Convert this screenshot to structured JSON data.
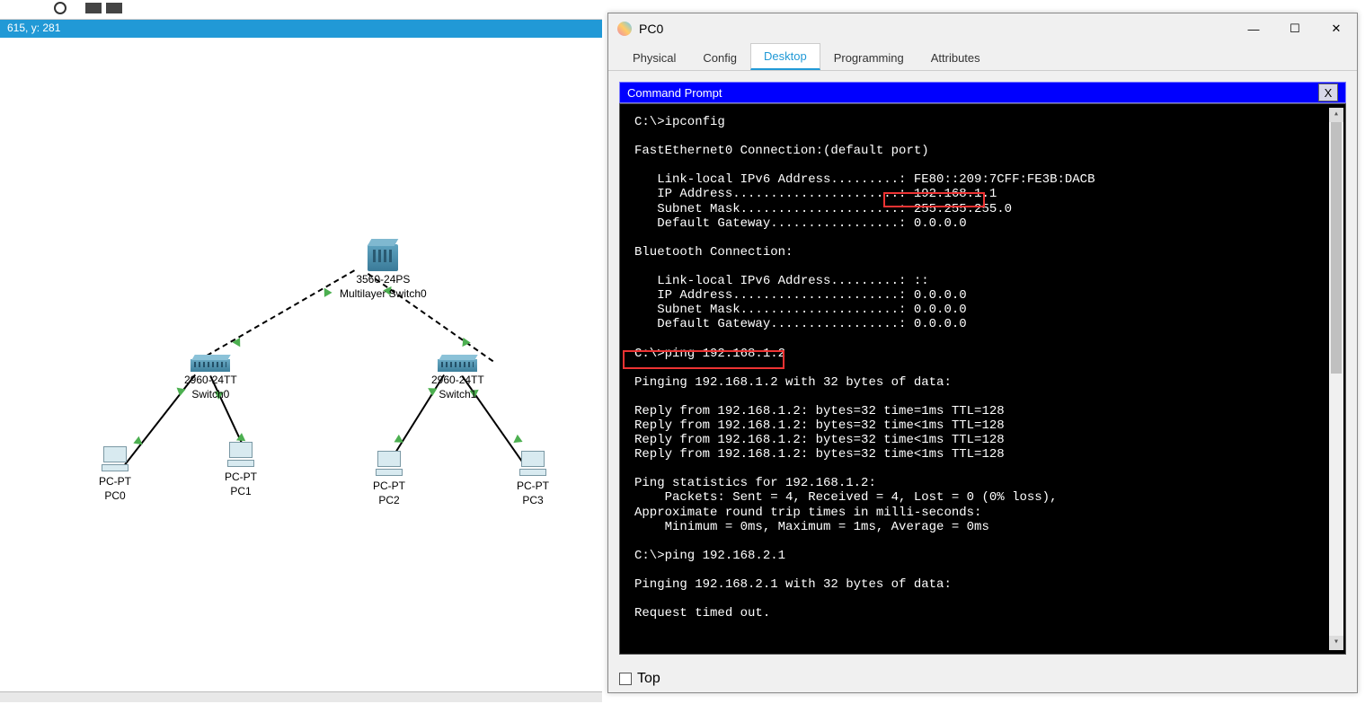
{
  "status_bar": "615, y: 281",
  "topology": {
    "ml_switch": {
      "label1": "3560-24PS",
      "label2": "Multilayer Switch0"
    },
    "switch0": {
      "label1": "2960-24TT",
      "label2": "Switch0"
    },
    "switch1": {
      "label1": "2960-24TT",
      "label2": "Switch1"
    },
    "pc0": {
      "label1": "PC-PT",
      "label2": "PC0"
    },
    "pc1": {
      "label1": "PC-PT",
      "label2": "PC1"
    },
    "pc2": {
      "label1": "PC-PT",
      "label2": "PC2"
    },
    "pc3": {
      "label1": "PC-PT",
      "label2": "PC3"
    }
  },
  "window": {
    "title": "PC0",
    "tabs": [
      "Physical",
      "Config",
      "Desktop",
      "Programming",
      "Attributes"
    ],
    "active_tab": 2,
    "cmd_title": "Command Prompt",
    "close_x": "X",
    "top_label": "Top",
    "terminal": "C:\\>ipconfig\n\nFastEthernet0 Connection:(default port)\n\n   Link-local IPv6 Address.........: FE80::209:7CFF:FE3B:DACB\n   IP Address......................: 192.168.1.1\n   Subnet Mask.....................: 255.255.255.0\n   Default Gateway.................: 0.0.0.0\n\nBluetooth Connection:\n\n   Link-local IPv6 Address.........: ::\n   IP Address......................: 0.0.0.0\n   Subnet Mask.....................: 0.0.0.0\n   Default Gateway.................: 0.0.0.0\n\nC:\\>ping 192.168.1.2\n\nPinging 192.168.1.2 with 32 bytes of data:\n\nReply from 192.168.1.2: bytes=32 time=1ms TTL=128\nReply from 192.168.1.2: bytes=32 time<1ms TTL=128\nReply from 192.168.1.2: bytes=32 time<1ms TTL=128\nReply from 192.168.1.2: bytes=32 time<1ms TTL=128\n\nPing statistics for 192.168.1.2:\n    Packets: Sent = 4, Received = 4, Lost = 0 (0% loss),\nApproximate round trip times in milli-seconds:\n    Minimum = 0ms, Maximum = 1ms, Average = 0ms\n\nC:\\>ping 192.168.2.1\n\nPinging 192.168.2.1 with 32 bytes of data:\n\nRequest timed out."
  }
}
